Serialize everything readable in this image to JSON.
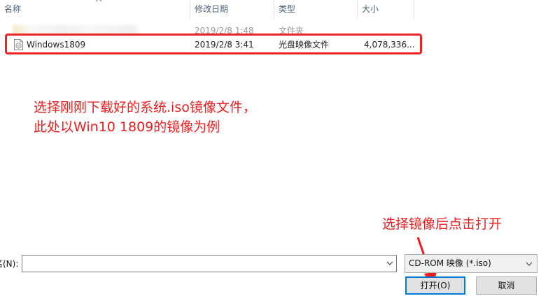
{
  "header": {
    "columns": [
      {
        "label": "名称"
      },
      {
        "label": "修改日期"
      },
      {
        "label": "类型"
      },
      {
        "label": "大小"
      }
    ]
  },
  "rows": [
    {
      "name": "",
      "date": "2019/2/8 1:48",
      "type": "文件夹",
      "size": ""
    },
    {
      "name": "Windows1809",
      "date": "2019/2/8 3:41",
      "type": "光盘映像文件",
      "size": "4,078,336..."
    }
  ],
  "annotations": {
    "line1": "选择刚刚下载好的系统.iso镜像文件，",
    "line2": "此处以Win10 1809的镜像为例",
    "button_hint": "选择镜像后点击打开"
  },
  "bottom": {
    "filename_label": "名(N):",
    "filename_value": "",
    "filter_value": "CD-ROM 映像 (*.iso)",
    "open_label": "打开(O)",
    "cancel_label": "取消"
  },
  "colors": {
    "annotation": "#ee1c1c",
    "highlight_border": "#ee2222",
    "focus_border": "#0078d7"
  }
}
